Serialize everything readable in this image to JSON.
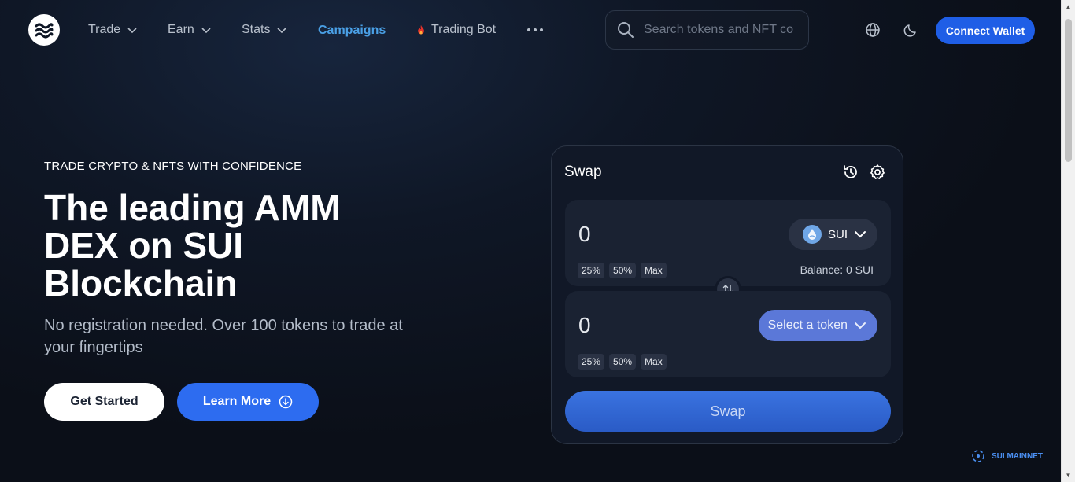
{
  "nav": {
    "items": [
      {
        "label": "Trade"
      },
      {
        "label": "Earn"
      },
      {
        "label": "Stats"
      },
      {
        "label": "Campaigns"
      },
      {
        "label": "Trading Bot"
      }
    ],
    "search_placeholder": "Search tokens and NFT co",
    "connect_label": "Connect Wallet",
    "icons": [
      "globe-icon",
      "moon-icon",
      "more-icon",
      "search-icon",
      "flame-icon",
      "chevron-down-icon"
    ]
  },
  "hero": {
    "eyebrow": "TRADE CRYPTO & NFTS WITH CONFIDENCE",
    "title": "The leading AMM DEX on SUI Blockchain",
    "subtitle": "No registration needed. Over 100 tokens to trade at your fingertips",
    "get_started_label": "Get Started",
    "learn_more_label": "Learn More"
  },
  "swap": {
    "title": "Swap",
    "from": {
      "amount": "0",
      "token": "SUI",
      "percent_buttons": [
        "25%",
        "50%",
        "Max"
      ],
      "balance": "Balance: 0 SUI"
    },
    "to": {
      "amount": "0",
      "token": "Select a token",
      "percent_buttons": [
        "25%",
        "50%",
        "Max"
      ]
    },
    "button_label": "Swap"
  },
  "network": {
    "label": "SUI MAINNET"
  },
  "colors": {
    "accent": "#1f5ee6",
    "campaigns": "#4aa0e6",
    "background": "#0f1726",
    "card": "#111827"
  }
}
